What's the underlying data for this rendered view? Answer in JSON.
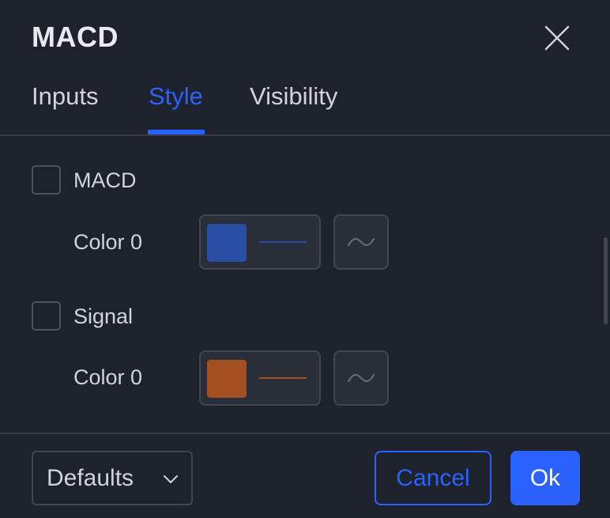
{
  "dialog": {
    "title": "MACD"
  },
  "tabs": [
    {
      "label": "Inputs",
      "active": false
    },
    {
      "label": "Style",
      "active": true
    },
    {
      "label": "Visibility",
      "active": false
    }
  ],
  "plots": [
    {
      "name": "MACD",
      "checked": false,
      "color_label": "Color 0",
      "color": "#2a4ea3",
      "line_style_icon": "line-style-icon"
    },
    {
      "name": "Signal",
      "checked": false,
      "color_label": "Color 0",
      "color": "#a34f22",
      "line_style_icon": "line-style-icon"
    }
  ],
  "footer": {
    "defaults_label": "Defaults",
    "cancel_label": "Cancel",
    "ok_label": "Ok"
  },
  "colors": {
    "accent": "#2962ff",
    "background": "#1e222d",
    "control_bg": "#2a2e39",
    "border": "#434651",
    "text": "#d1d4dc"
  },
  "icons": {
    "close": "close-icon",
    "dropdown": "chevron-down-icon"
  }
}
